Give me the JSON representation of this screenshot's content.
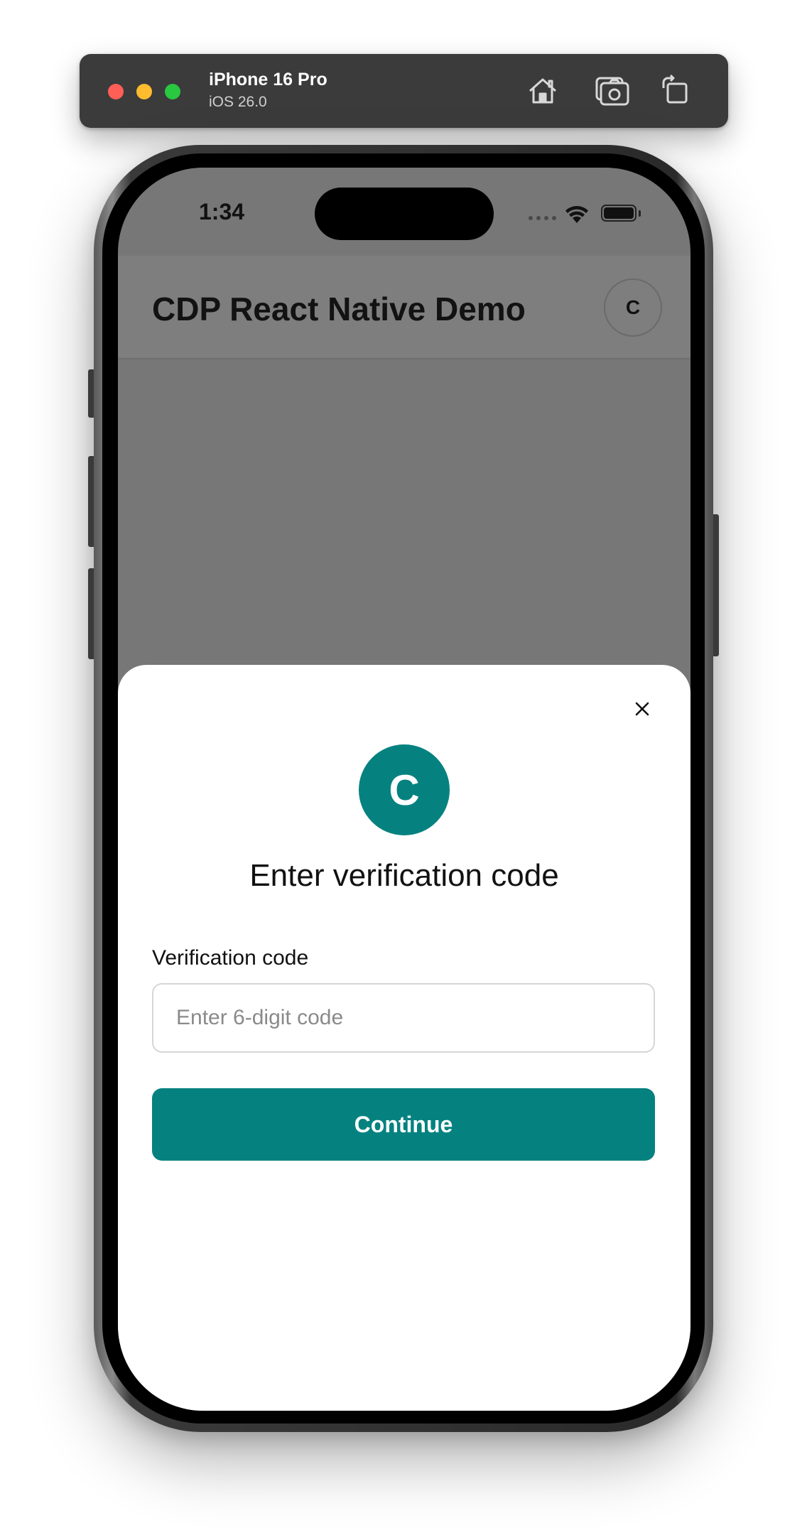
{
  "simulator": {
    "device_name": "iPhone 16 Pro",
    "os_version": "iOS 26.0",
    "toolbar_icons": [
      "home-icon",
      "screenshot-icon",
      "rotate-icon"
    ]
  },
  "status_bar": {
    "time": "1:34"
  },
  "app_header": {
    "title": "CDP React Native Demo",
    "avatar_letter": "C"
  },
  "modal": {
    "logo_letter": "C",
    "title": "Enter verification code",
    "field_label": "Verification code",
    "input_value": "",
    "input_placeholder": "Enter 6-digit code",
    "continue_label": "Continue"
  },
  "colors": {
    "accent": "#058280",
    "overlay": "#777777",
    "toolbar": "#3b3b3b"
  }
}
